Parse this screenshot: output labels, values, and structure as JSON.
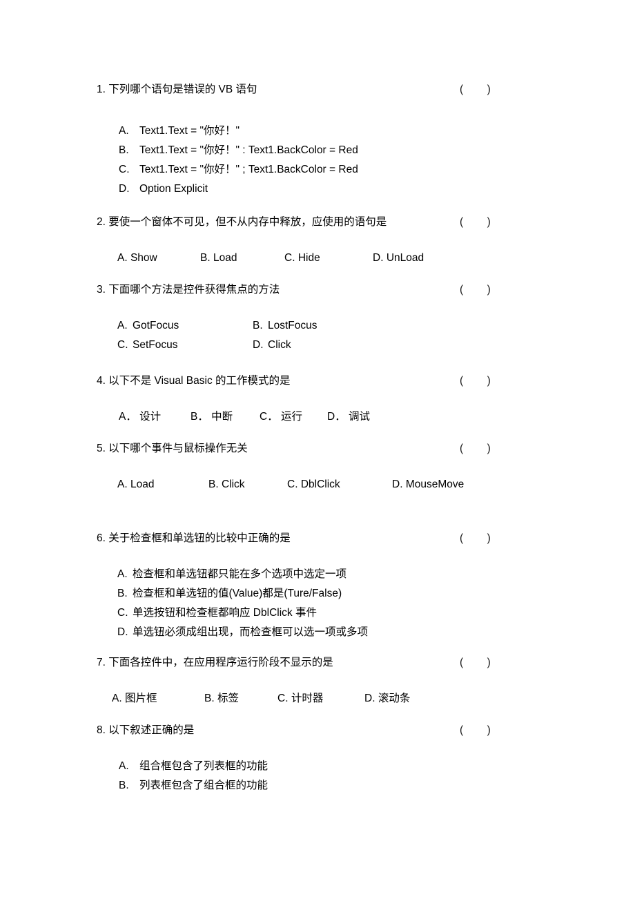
{
  "document": {
    "paren_marker": "(        )"
  },
  "questions": [
    {
      "number": "1.",
      "stem": "下列哪个语句是错误的 VB 语句",
      "options": [
        {
          "letter": "A.",
          "text": "Text1.Text = \"你好！\""
        },
        {
          "letter": "B.",
          "text": "Text1.Text = \"你好！\" : Text1.BackColor = Red"
        },
        {
          "letter": "C.",
          "text": "Text1.Text = \"你好！\" ; Text1.BackColor = Red"
        },
        {
          "letter": "D.",
          "text": "Option Explicit"
        }
      ]
    },
    {
      "number": "2.",
      "stem": "要使一个窗体不可见，但不从内存中释放，应使用的语句是",
      "options": [
        {
          "letter": "A.",
          "text": "Show"
        },
        {
          "letter": "B.",
          "text": "Load"
        },
        {
          "letter": "C.",
          "text": "Hide"
        },
        {
          "letter": "D.",
          "text": "UnLoad"
        }
      ]
    },
    {
      "number": "3.",
      "stem": "下面哪个方法是控件获得焦点的方法",
      "options": [
        {
          "letter": "A.",
          "text": "GotFocus"
        },
        {
          "letter": "B.",
          "text": "LostFocus"
        },
        {
          "letter": "C.",
          "text": "SetFocus"
        },
        {
          "letter": "D.",
          "text": "Click"
        }
      ]
    },
    {
      "number": "4.",
      "stem": "以下不是 Visual Basic 的工作模式的是",
      "options": [
        {
          "letter": "A．",
          "text": "设计"
        },
        {
          "letter": "B．",
          "text": "中断"
        },
        {
          "letter": "C．",
          "text": "运行"
        },
        {
          "letter": "D．",
          "text": "调试"
        }
      ]
    },
    {
      "number": "5.",
      "stem": "以下哪个事件与鼠标操作无关",
      "options": [
        {
          "letter": "A.",
          "text": "Load"
        },
        {
          "letter": "B.",
          "text": "Click"
        },
        {
          "letter": "C.",
          "text": "DblClick"
        },
        {
          "letter": "D.",
          "text": "MouseMove"
        }
      ]
    },
    {
      "number": "6.",
      "stem": "关于检查框和单选钮的比较中正确的是",
      "options": [
        {
          "letter": "A.",
          "text": "检查框和单选钮都只能在多个选项中选定一项"
        },
        {
          "letter": "B.",
          "text": "检查框和单选钮的值(Value)都是(Ture/False)"
        },
        {
          "letter": "C.",
          "text": "单选按钮和检查框都响应 DblClick 事件"
        },
        {
          "letter": "D.",
          "text": "单选钮必须成组出现，而检查框可以选一项或多项"
        }
      ]
    },
    {
      "number": "7.",
      "stem": "下面各控件中，在应用程序运行阶段不显示的是",
      "options": [
        {
          "letter": "A.",
          "text": "图片框"
        },
        {
          "letter": "B.",
          "text": "标签"
        },
        {
          "letter": "C.",
          "text": "计时器"
        },
        {
          "letter": "D.",
          "text": "滚动条"
        }
      ]
    },
    {
      "number": "8.",
      "stem": "以下叙述正确的是",
      "options": [
        {
          "letter": "A.",
          "text": "组合框包含了列表框的功能"
        },
        {
          "letter": "B.",
          "text": "列表框包含了组合框的功能"
        }
      ]
    }
  ]
}
